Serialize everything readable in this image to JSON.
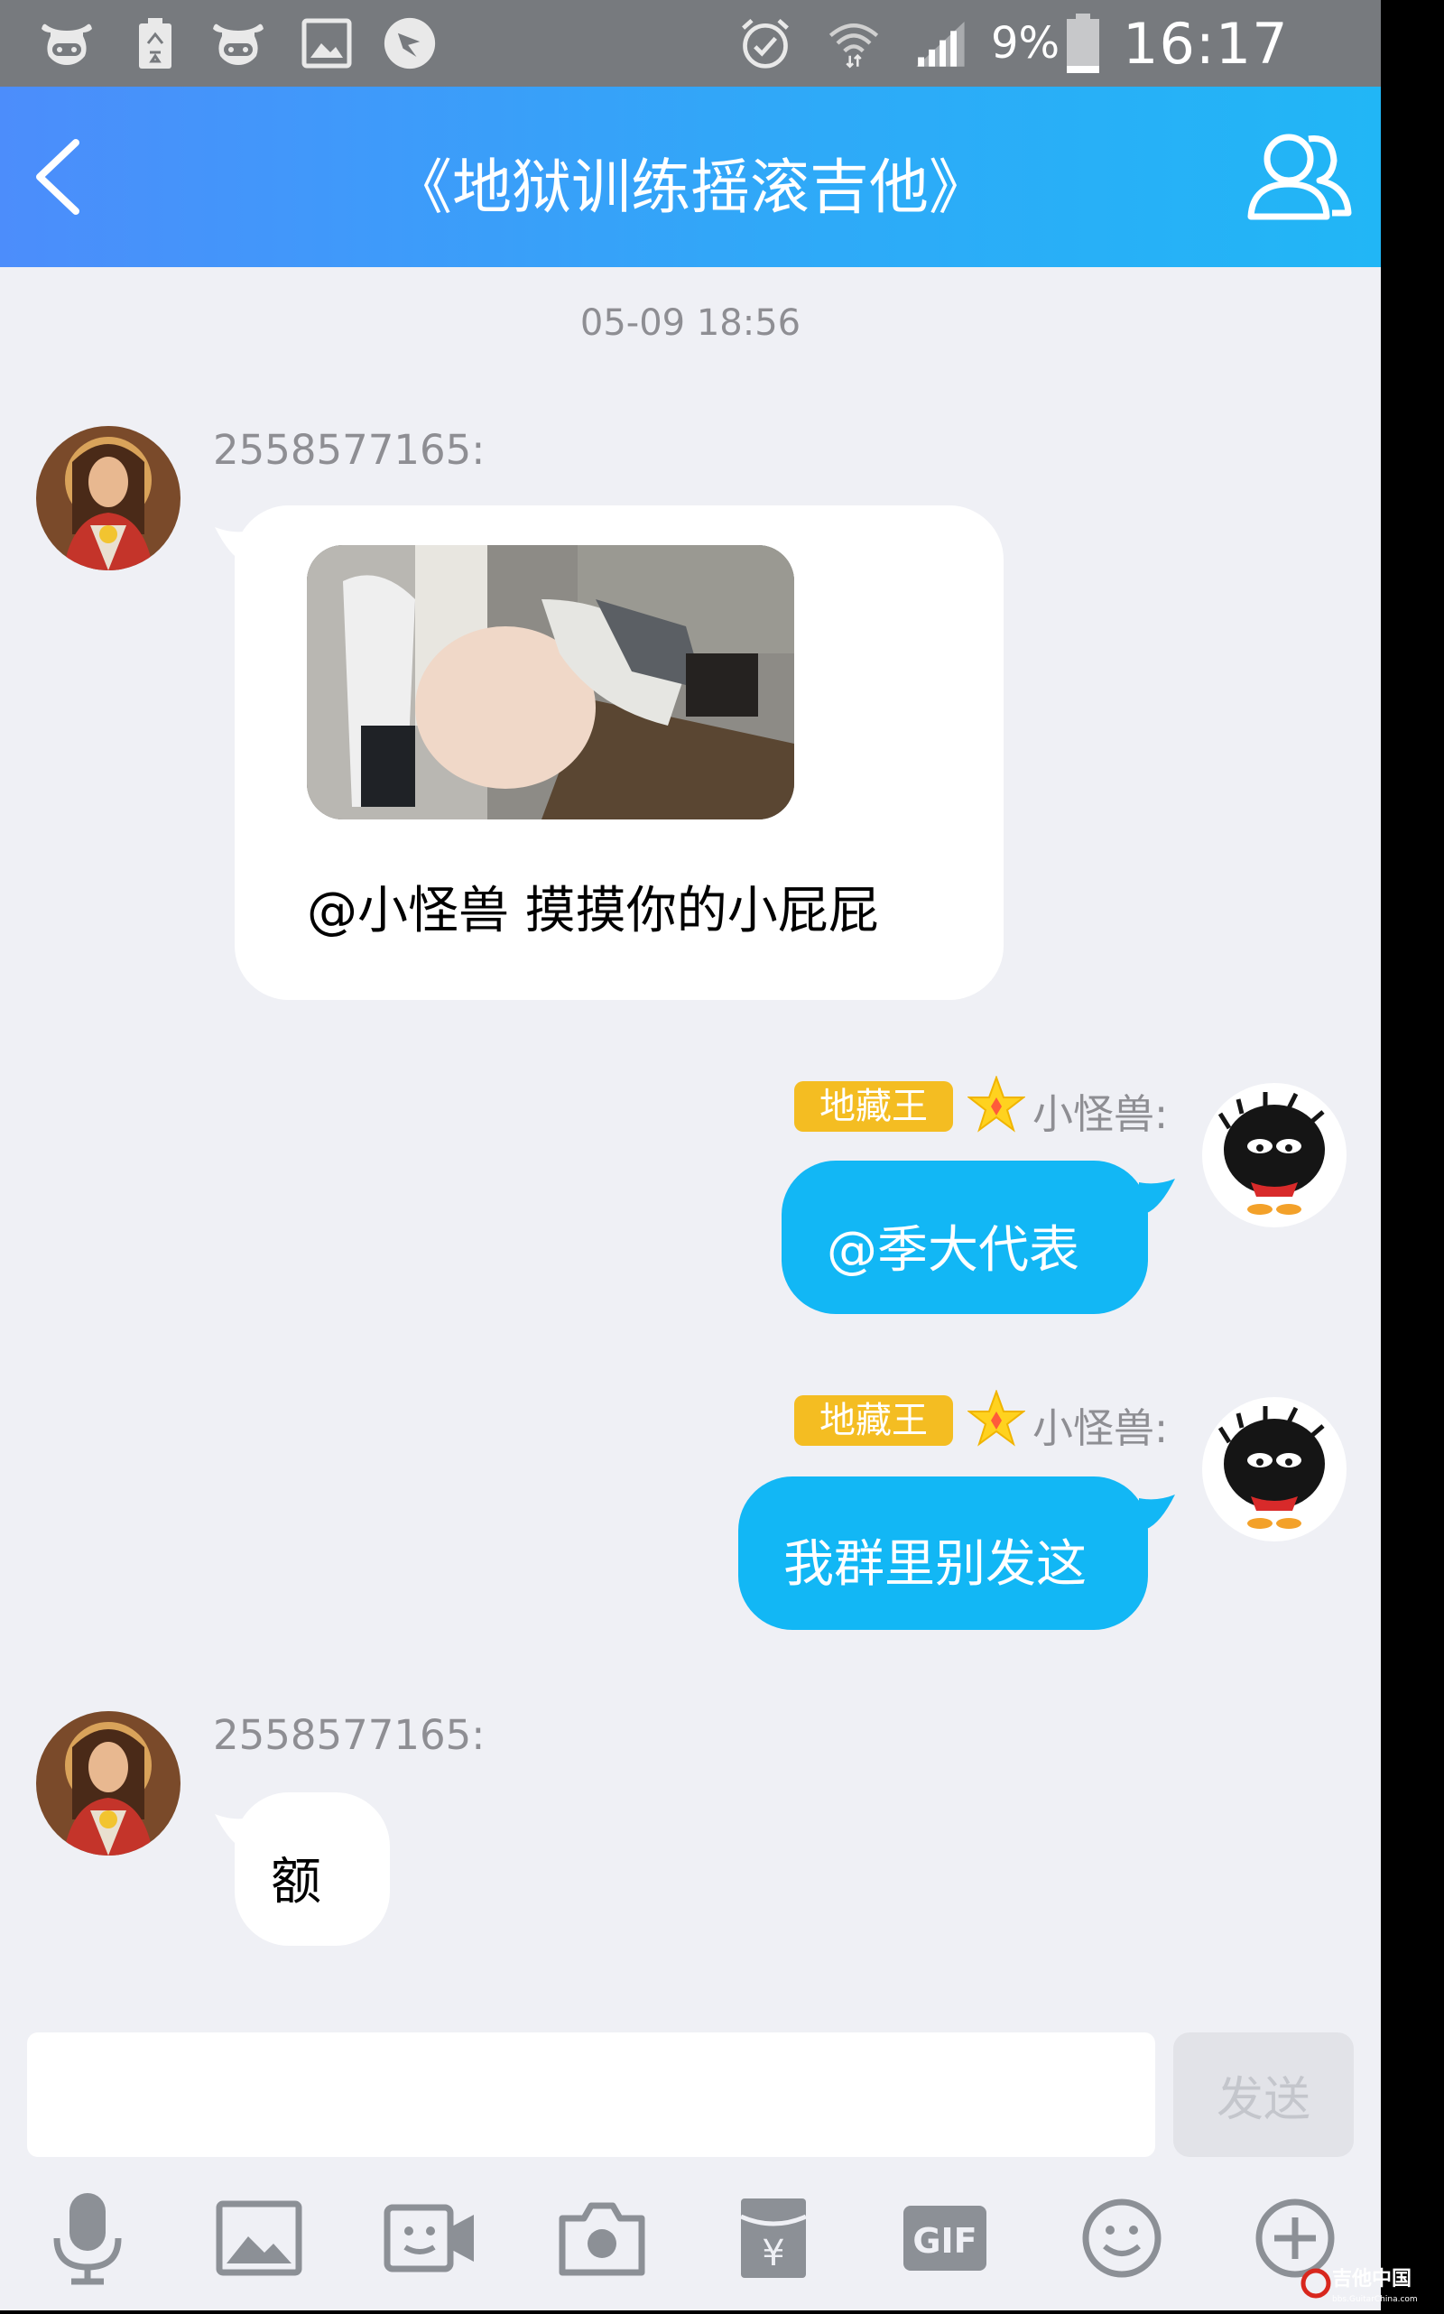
{
  "status_bar": {
    "notification_icons": [
      "cow-icon",
      "battery-saver-icon",
      "cow-icon",
      "image-icon",
      "dragonfly-icon"
    ],
    "system_icons": [
      "alarm-icon",
      "wifi-icon",
      "signal-icon",
      "battery-icon"
    ],
    "battery_percent": "9%",
    "time": "16:17"
  },
  "header": {
    "title": "《地狱训练摇滚吉他》",
    "back_icon": "chevron-left-icon",
    "members_icon": "group-members-icon"
  },
  "chat": {
    "timestamp": "05-09 18:56",
    "messages": [
      {
        "direction": "incoming",
        "sender": "2558577165:",
        "has_image": true,
        "text": "@小怪兽 摸摸你的小屁屁"
      },
      {
        "direction": "outgoing",
        "badge": "地藏王",
        "sender": "小怪兽:",
        "text": "@季大代表"
      },
      {
        "direction": "outgoing",
        "badge": "地藏王",
        "sender": "小怪兽:",
        "text": "我群里别发这"
      },
      {
        "direction": "incoming",
        "sender": "2558577165:",
        "text": "额"
      }
    ]
  },
  "composer": {
    "input_value": "",
    "send_label": "发送",
    "tools": [
      "microphone-icon",
      "image-icon",
      "video-call-icon",
      "camera-icon",
      "red-packet-icon",
      "gif-icon",
      "emoji-icon",
      "plus-icon"
    ],
    "gif_label": "GIF",
    "redpacket_label": "¥"
  },
  "watermark": {
    "text": "吉他中国",
    "subtext": "bbs.GuitarChina.com"
  },
  "colors": {
    "header_start": "#4c8dfb",
    "header_end": "#21b6f6",
    "outgoing_bubble": "#12b7f5",
    "badge": "#f4bd22",
    "background": "#eff0f5"
  }
}
